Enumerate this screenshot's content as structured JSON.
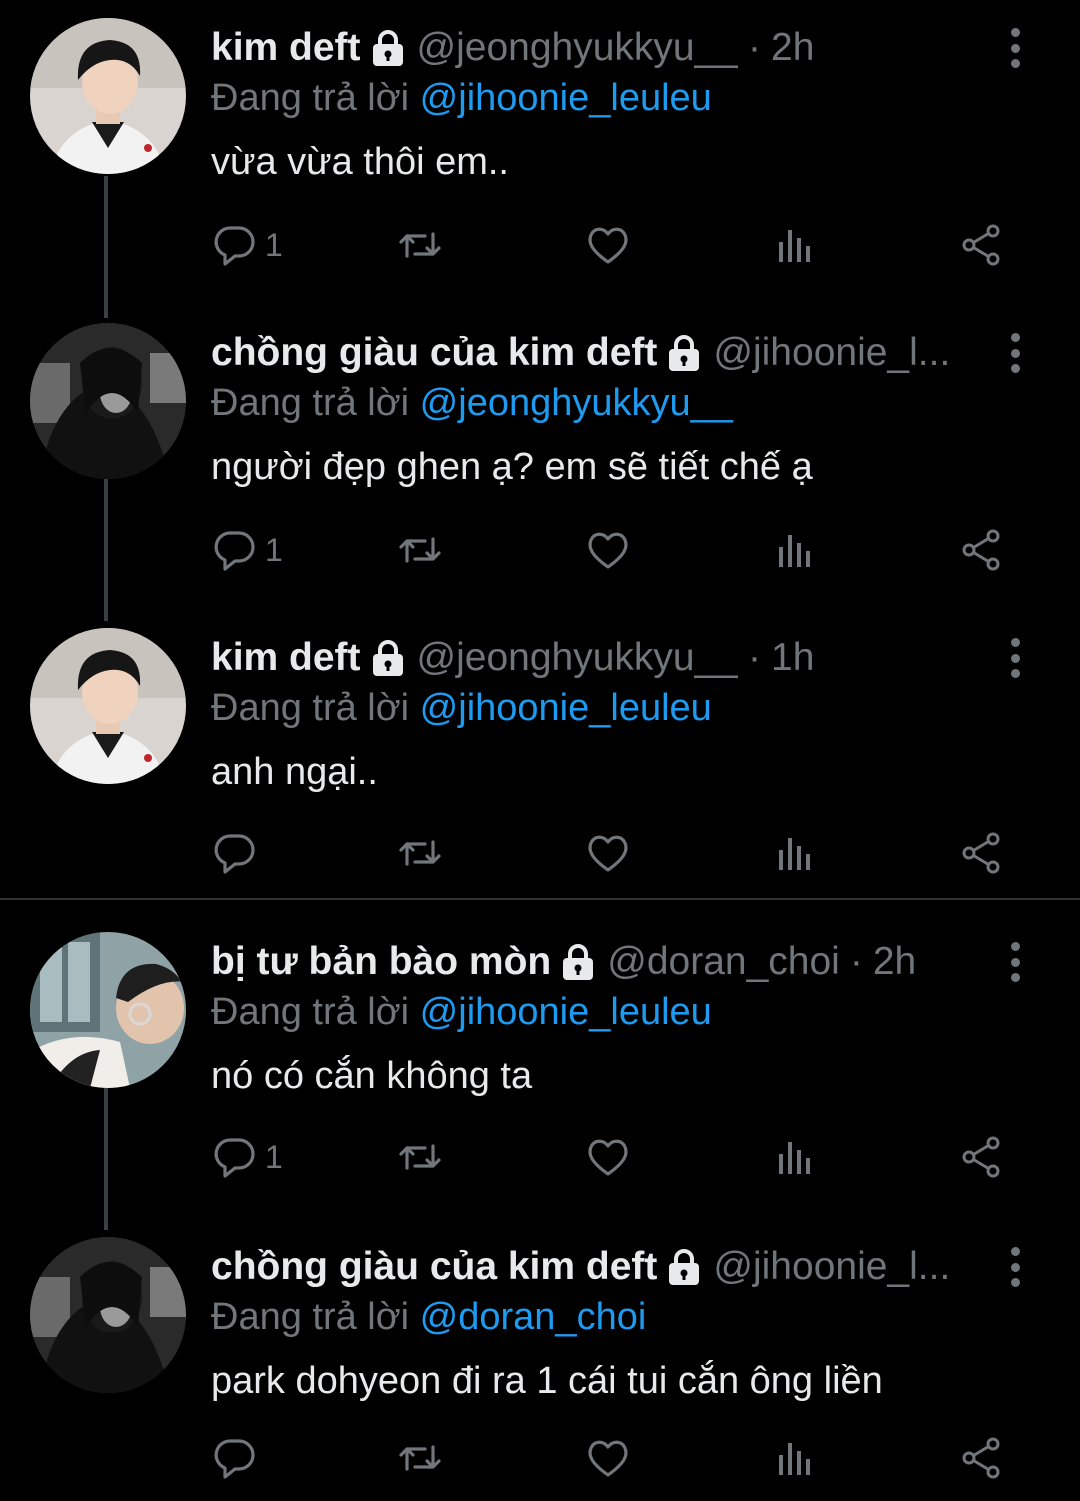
{
  "tweets": [
    {
      "name": "kim deft",
      "handle": "@jeonghyukkyu__",
      "dot": "·",
      "time": "2h",
      "reply_prefix": "Đang trả lời",
      "reply_to": "@jihoonie_leuleu",
      "text": "vừa vừa thôi em..",
      "reply_count": "1",
      "avatar": "avatar-boy"
    },
    {
      "name": "chồng giàu của kim deft",
      "handle": "@jihoonie_l...",
      "dot": "",
      "time": "",
      "reply_prefix": "Đang trả lời",
      "reply_to": "@jeonghyukkyu__",
      "text": "người đẹp ghen ạ? em sẽ tiết chế ạ",
      "reply_count": "1",
      "avatar": "avatar-hooded"
    },
    {
      "name": "kim deft",
      "handle": "@jeonghyukkyu__",
      "dot": "·",
      "time": "1h",
      "reply_prefix": "Đang trả lời",
      "reply_to": "@jihoonie_leuleu",
      "text": "anh ngại..",
      "reply_count": "",
      "avatar": "avatar-boy"
    },
    {
      "name": "bị tư bản bào mòn",
      "handle": "@doran_choi",
      "dot": "·",
      "time": "2h",
      "reply_prefix": "Đang trả lời",
      "reply_to": "@jihoonie_leuleu",
      "text": "nó có cắn không ta",
      "reply_count": "1",
      "avatar": "avatar-glasses"
    },
    {
      "name": "chồng giàu của kim deft",
      "handle": "@jihoonie_l...",
      "dot": "",
      "time": "",
      "reply_prefix": "Đang trả lời",
      "reply_to": "@doran_choi",
      "text": "park dohyeon đi ra 1 cái tui cắn ông liền",
      "reply_count": "",
      "avatar": "avatar-hooded"
    }
  ],
  "icons": {
    "reply": "speech-bubble-icon",
    "retweet": "retweet-icon",
    "like": "heart-icon",
    "views": "bar-chart-icon",
    "share": "share-icon",
    "lock": "lock-icon",
    "more": "vertical-dots-icon"
  },
  "colors": {
    "background": "#000000",
    "text": "#e7e9ea",
    "muted": "#71767b",
    "link": "#1d9bf0"
  }
}
